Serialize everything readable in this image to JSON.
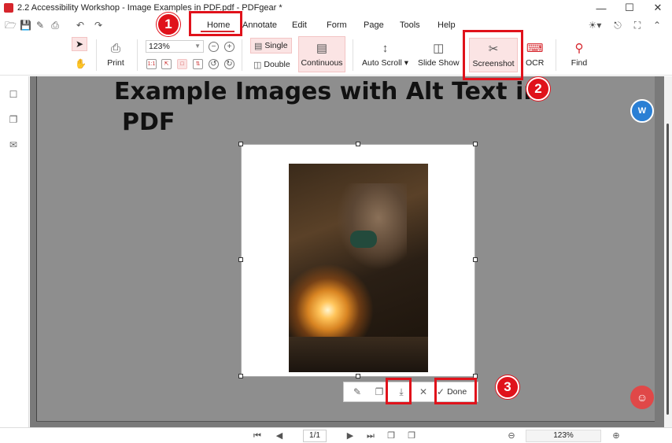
{
  "window": {
    "title": "2.2 Accessibility Workshop - Image Examples in PDF.pdf - PDFgear *",
    "controls": [
      "minimize",
      "maximize",
      "close"
    ]
  },
  "menu": {
    "items": [
      "Home",
      "Annotate",
      "Edit",
      "Form",
      "Page",
      "Tools",
      "Help"
    ],
    "active": "Home"
  },
  "toolbar": {
    "print_label": "Print",
    "zoom_value": "123%",
    "single_label": "Single",
    "double_label": "Double",
    "continuous_label": "Continuous",
    "auto_scroll_label": "Auto Scroll",
    "slide_show_label": "Slide Show",
    "screenshot_label": "Screenshot",
    "ocr_label": "OCR",
    "find_label": "Find"
  },
  "document": {
    "heading_line1": "Example Images with Alt Text in",
    "heading_line2": "PDF"
  },
  "screenshot_bar": {
    "done_label": "Done"
  },
  "callouts": [
    "1",
    "2",
    "3"
  ],
  "statusbar": {
    "page_indicator": "1/1",
    "zoom_value": "123%"
  },
  "colors": {
    "accent_red": "#e0121b",
    "brand_red": "#d6252c",
    "doc_background": "#7a7a7a"
  }
}
